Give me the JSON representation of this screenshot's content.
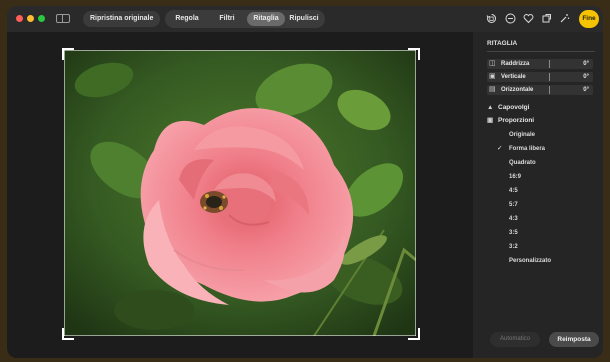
{
  "toolbar": {
    "revert_label": "Ripristina originale",
    "tabs": [
      {
        "label": "Regola",
        "active": false
      },
      {
        "label": "Filtri",
        "active": false
      },
      {
        "label": "Ritaglia",
        "active": true
      },
      {
        "label": "Ripulisci",
        "active": false
      }
    ],
    "done_label": "Fine",
    "icons": [
      "rotate-icon",
      "minus-circle-icon",
      "heart-icon",
      "crop-icon",
      "magic-wand-icon"
    ]
  },
  "panel": {
    "title": "RITAGLIA",
    "sliders": [
      {
        "label": "Raddrizza",
        "value": "0°",
        "icon": "straighten-icon"
      },
      {
        "label": "Verticale",
        "value": "0°",
        "icon": "vertical-icon"
      },
      {
        "label": "Orizzontale",
        "value": "0°",
        "icon": "horizontal-icon"
      }
    ],
    "flip_label": "Capovolgi",
    "aspect_label": "Proporzioni",
    "ratios": [
      {
        "label": "Originale",
        "checked": false
      },
      {
        "label": "Forma libera",
        "checked": true
      },
      {
        "label": "Quadrato",
        "checked": false
      },
      {
        "label": "16:9",
        "checked": false
      },
      {
        "label": "4:5",
        "checked": false
      },
      {
        "label": "5:7",
        "checked": false
      },
      {
        "label": "4:3",
        "checked": false
      },
      {
        "label": "3:5",
        "checked": false
      },
      {
        "label": "3:2",
        "checked": false
      },
      {
        "label": "Personalizzato",
        "checked": false
      }
    ],
    "auto_label": "Automatico",
    "reset_label": "Reimposta"
  },
  "colors": {
    "accent": "#f5c300",
    "active_tab": "#6a6a6a"
  }
}
